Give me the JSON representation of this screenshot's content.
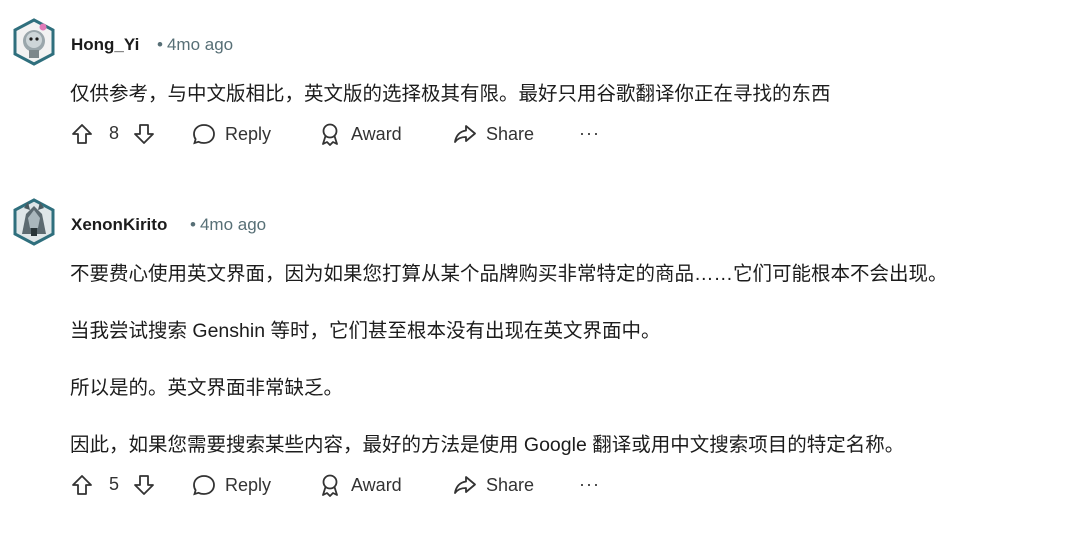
{
  "comments": [
    {
      "author": "Hong_Yi",
      "time": "4mo ago",
      "paragraphs": [
        "仅供参考，与中文版相比，英文版的选择极其有限。最好只用谷歌翻译你正在寻找的东西"
      ],
      "votes": "8",
      "reply_label": "Reply",
      "award_label": "Award",
      "share_label": "Share",
      "more_label": "···"
    },
    {
      "author": "XenonKirito",
      "time": "4mo ago",
      "paragraphs": [
        "不要费心使用英文界面，因为如果您打算从某个品牌购买非常特定的商品……它们可能根本不会出现。",
        "当我尝试搜索 Genshin 等时，它们甚至根本没有出现在英文界面中。",
        "所以是的。英文界面非常缺乏。",
        "因此，如果您需要搜索某些内容，最好的方法是使用 Google 翻译或用中文搜索项目的特定名称。"
      ],
      "votes": "5",
      "reply_label": "Reply",
      "award_label": "Award",
      "share_label": "Share",
      "more_label": "···"
    }
  ],
  "colors": {
    "text": "#1c1c1c",
    "meta": "#576f76",
    "avatar_border": "#3b7d8a"
  }
}
